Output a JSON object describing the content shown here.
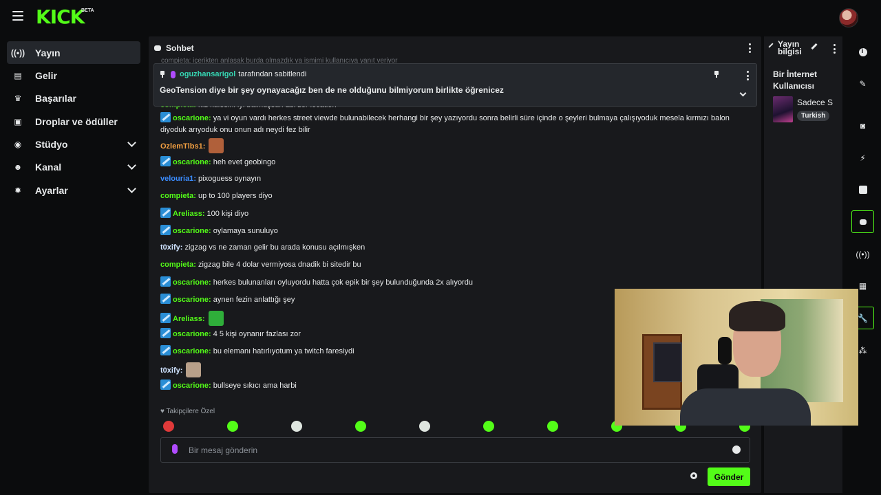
{
  "header": {
    "logo": "KICK",
    "beta": "BETA"
  },
  "sidebar": {
    "items": [
      {
        "label": "Yayın",
        "icon": "broadcast-icon",
        "active": true
      },
      {
        "label": "Gelir",
        "icon": "revenue-icon"
      },
      {
        "label": "Başarılar",
        "icon": "trophy-icon"
      },
      {
        "label": "Droplar ve ödüller",
        "icon": "gift-icon"
      },
      {
        "label": "Stüdyo",
        "icon": "studio-icon",
        "expandable": true
      },
      {
        "label": "Kanal",
        "icon": "channel-icon",
        "expandable": true
      },
      {
        "label": "Ayarlar",
        "icon": "gear-icon",
        "expandable": true
      }
    ]
  },
  "chat": {
    "title": "Sohbet",
    "faded_line": "compieta: içerikten anlaşak burda olmazdık ya ismimi kullanıcıya yanıt veriyor",
    "pinned": {
      "by_user": "oguzhansarigol",
      "by_suffix": "tarafından sabitlendi",
      "message": "GeoTension diye bir şey oynayacağız ben de ne olduğunu bilmiyorum birlikte öğrenicez"
    },
    "messages": [
      {
        "user": "compieta",
        "color": "#53fc18",
        "badge": false,
        "text": "kız kulesini iyi bulmuşsun abi zor location"
      },
      {
        "user": "oscarione",
        "color": "#53fc18",
        "badge": true,
        "text": "ya vi oyun vardı herkes street viewde bulunabilecek herhangi bir şey yazıyordu sonra belirli süre içinde o şeyleri bulmaya çalışıyoduk mesela kırmızı balon diyoduk arıyoduk onu onun adı neydi fez bilir"
      },
      {
        "user": "OzlemTlbs1",
        "color": "#f5a142",
        "badge": false,
        "text": "",
        "emote": "#b0603a"
      },
      {
        "user": "oscarione",
        "color": "#53fc18",
        "badge": true,
        "text": "heh evet geobingo"
      },
      {
        "user": "velouria1",
        "color": "#3b8cff",
        "badge": false,
        "text": "pixoguess oynayın"
      },
      {
        "user": "compieta",
        "color": "#53fc18",
        "badge": false,
        "text": "up to 100 players diyo"
      },
      {
        "user": "Areliass",
        "color": "#53fc18",
        "badge": true,
        "text": "100 kişi diyo"
      },
      {
        "user": "oscarione",
        "color": "#53fc18",
        "badge": true,
        "text": "oylamaya sunuluyo"
      },
      {
        "user": "t0xify",
        "color": "#cfe3ff",
        "badge": false,
        "text": "zigzag vs ne zaman gelir bu arada konusu açılmışken"
      },
      {
        "user": "compieta",
        "color": "#53fc18",
        "badge": false,
        "text": "zigzag bile 4 dolar vermiyosa dnadik bi sitedir bu"
      },
      {
        "user": "oscarione",
        "color": "#53fc18",
        "badge": true,
        "text": "herkes bulunanları oyluyordu hatta çok epik bir şey bulunduğunda 2x alıyordu"
      },
      {
        "user": "oscarione",
        "color": "#53fc18",
        "badge": true,
        "text": "aynen fezin anlattığı şey"
      },
      {
        "user": "Areliass",
        "color": "#53fc18",
        "badge": true,
        "text": "",
        "emote": "#2fae3a"
      },
      {
        "user": "oscarione",
        "color": "#53fc18",
        "badge": true,
        "text": "4 5 kişi oynanır fazlası zor"
      },
      {
        "user": "oscarione",
        "color": "#53fc18",
        "badge": true,
        "text": "bu elemanı hatırlıyotum ya twitch faresiydi"
      },
      {
        "user": "t0xify",
        "color": "#cfe3ff",
        "badge": false,
        "text": "",
        "emote": "#b8a08a"
      },
      {
        "user": "oscarione",
        "color": "#53fc18",
        "badge": true,
        "text": "bullseye sıkıcı ama harbi"
      }
    ],
    "follower_note": "Takipçilere Özel",
    "emote_colors": [
      "#e03a3a",
      "#53fc18",
      "#dfe6e0",
      "#53fc18",
      "#dfe6e0",
      "#53fc18",
      "#53fc18",
      "#53fc18",
      "#53fc18",
      "#53fc18"
    ],
    "input_placeholder": "Bir mesaj gönderin",
    "send_label": "Gönder"
  },
  "stream_info": {
    "title": "Yayın bilgisi",
    "stream_title": "Bir İnternet Kullanıcısı",
    "category": "Sadece S",
    "tag": "Turkish"
  },
  "rail": {
    "icons": [
      "info-icon",
      "edit-icon",
      "scene-icon",
      "flash-icon",
      "notes-icon",
      "chat-icon",
      "broadcast-icon",
      "layout-icon",
      "wrench-icon",
      "share-icon"
    ],
    "active": [
      "chat-icon",
      "wrench-icon"
    ]
  },
  "colors": {
    "accent": "#53fc18",
    "panel": "#18191c",
    "background": "#0b0c0d"
  }
}
